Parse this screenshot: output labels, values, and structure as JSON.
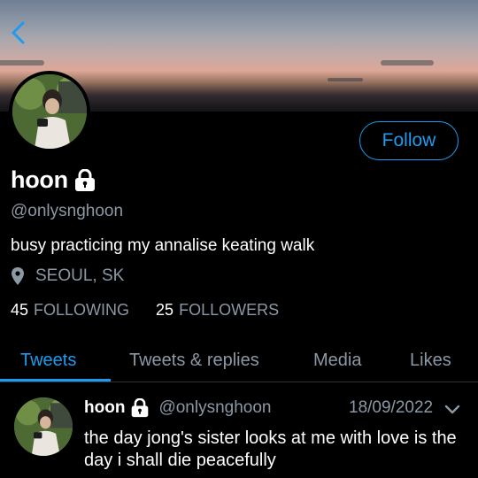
{
  "profile": {
    "display_name": "hoon",
    "handle": "@onlysnghoon",
    "bio": "busy practicing my annalise keating walk",
    "location": "SEOUL, SK",
    "follow_label": "Follow",
    "protected_icon": "lock-icon",
    "location_icon": "map-pin-icon"
  },
  "stats": {
    "following_count": "45",
    "following_label": "FOLLOWING",
    "followers_count": "25",
    "followers_label": "FOLLOWERS"
  },
  "tabs": [
    {
      "label": "Tweets",
      "active": true
    },
    {
      "label": "Tweets & replies",
      "active": false
    },
    {
      "label": "Media",
      "active": false
    },
    {
      "label": "Likes",
      "active": false
    }
  ],
  "tweet": {
    "author": "hoon",
    "handle": "@onlysnghoon",
    "date": "18/09/2022",
    "text": "the day jong's sister looks at me with love is the day i shall die peacefully"
  },
  "colors": {
    "accent": "#1d9bf0",
    "background": "#000000",
    "secondary_text": "#8b98a5"
  }
}
